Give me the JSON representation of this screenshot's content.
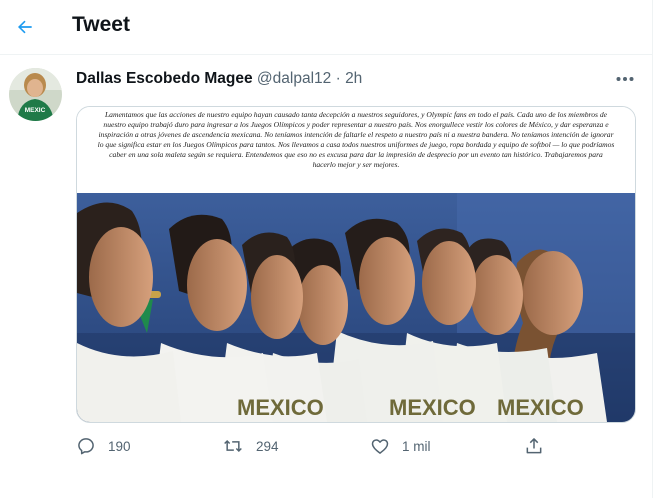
{
  "header": {
    "title": "Tweet",
    "back_icon": "arrow-left-icon",
    "accent": "#1d9bf0"
  },
  "tweet": {
    "author_name": "Dallas Escobedo Magee",
    "handle": "@dalpal12",
    "separator": "·",
    "time": "2h",
    "more_icon": "more-horizontal-icon",
    "avatar_jersey_text": "MEXIC",
    "statement": "Lamentamos que las acciones de nuestro equipo hayan causado tanta decepción a nuestros seguidores, y Olympic fans en todo el país. Cada uno de los miembros de nuestro equipo trabajó duro para ingresar a los Juegos Olímpicos y poder representar a nuestro país. Nos enorgullece vestir los colores de México, y dar esperanza e inspiración a otras jóvenes de ascendencia mexicana. No teníamos intención de faltarle el respeto a nuestro país ni a nuestra bandera. No teníamos intención de ignorar lo que significa estar en los Juegos Olímpicos para tantos. Nos llevamos a casa todos nuestros uniformes de juego, ropa bordada y equipo de softbol — lo que podríamos caber en una sola maleta según se requiera. Entendemos que eso no es excusa para dar la impresión de desprecio por un evento tan histórico. Trabajaremos para hacerlo mejor y ser mejores.",
    "jersey_text": "MEXICO",
    "actions": {
      "reply": {
        "icon": "reply-icon",
        "count": "190"
      },
      "retweet": {
        "icon": "retweet-icon",
        "count": "294"
      },
      "like": {
        "icon": "heart-icon",
        "count": "1 mil"
      },
      "share": {
        "icon": "share-icon"
      }
    }
  }
}
